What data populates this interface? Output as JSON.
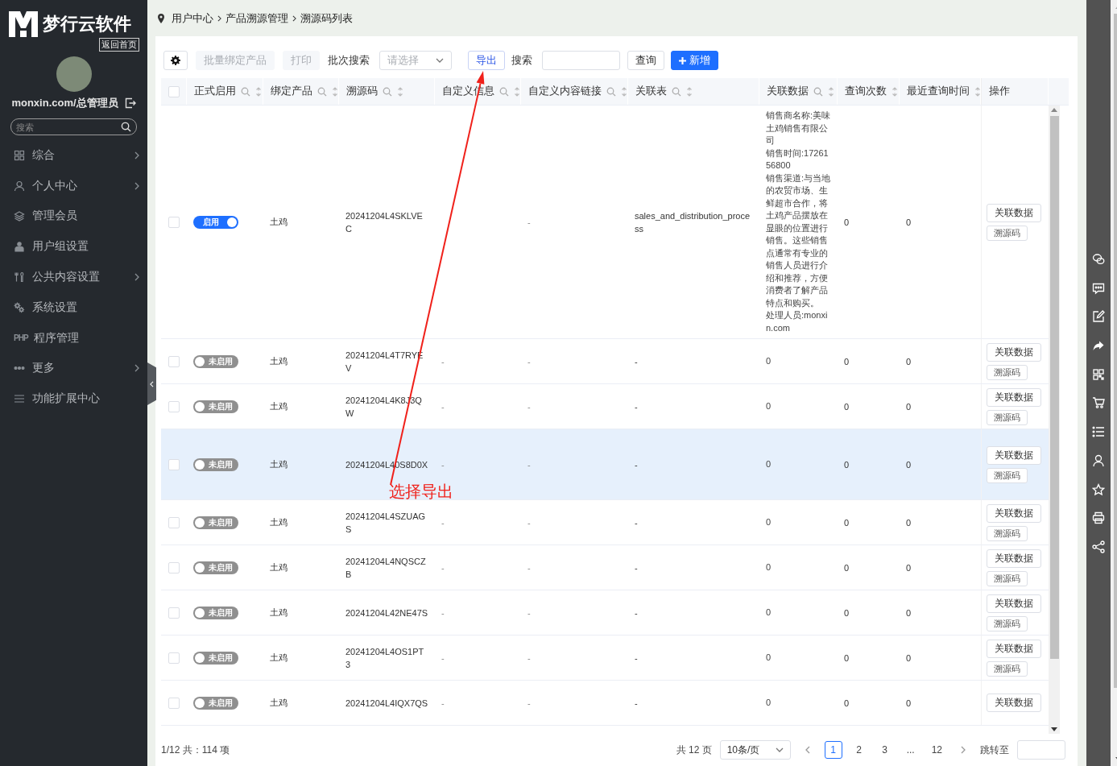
{
  "sidebar": {
    "brand": "梦行云软件",
    "home_link": "返回首页",
    "user": "monxin.com/总管理员",
    "search": {
      "placeholder": "搜索"
    },
    "items": [
      {
        "label": "综合",
        "expandable": true
      },
      {
        "label": "个人中心",
        "expandable": true
      },
      {
        "label": "管理会员",
        "expandable": false
      },
      {
        "label": "用户组设置",
        "expandable": false
      },
      {
        "label": "公共内容设置",
        "expandable": true
      },
      {
        "label": "系统设置",
        "expandable": false
      },
      {
        "label": "程序管理",
        "expandable": false,
        "icon_text": "PHP"
      },
      {
        "label": "更多",
        "expandable": true
      },
      {
        "label": "功能扩展中心",
        "expandable": false
      }
    ]
  },
  "breadcrumb": [
    "用户中心",
    "产品溯源管理",
    "溯源码列表"
  ],
  "toolbar": {
    "batch_bind": {
      "label": "批量绑定产品",
      "disabled": true
    },
    "print": {
      "label": "打印",
      "disabled": true
    },
    "batch_search": {
      "label": "批次搜索",
      "placeholder": "请选择"
    },
    "export": "导出",
    "search": {
      "label": "搜索"
    },
    "query": "查询",
    "add": "新增"
  },
  "table": {
    "all_checked": false,
    "columns": [
      {
        "label": "正式启用",
        "searchable": true,
        "sortable": true
      },
      {
        "label": "绑定产品",
        "searchable": true,
        "sortable": true
      },
      {
        "label": "溯源码",
        "searchable": true,
        "sortable": true
      },
      {
        "label": "自定义信息",
        "searchable": true,
        "sortable": true
      },
      {
        "label": "自定义内容链接",
        "searchable": true,
        "sortable": true
      },
      {
        "label": "关联表",
        "searchable": true,
        "sortable": true
      },
      {
        "label": "关联数据",
        "searchable": true,
        "sortable": true
      },
      {
        "label": "查询次数",
        "searchable": false,
        "sortable": true
      },
      {
        "label": "最近查询时间",
        "searchable": false,
        "sortable": true
      },
      {
        "label": "操作",
        "searchable": false,
        "sortable": false
      }
    ],
    "rows": [
      {
        "selected": false,
        "checked": false,
        "enabled": true,
        "toggle_label": "启用",
        "product": "土鸡",
        "code": "20241204L4SKLVEC",
        "custom_link": "-",
        "related_table": "sales_and_distribution_process",
        "related_data": [
          "销售商名称:美味土鸡销售有限公司",
          "销售时间:1726156800",
          "销售渠道:与当地的农贸市场、生鲜超市合作，将土鸡产品摆放在显眼的位置进行销售。这些销售点通常有专业的销售人员进行介绍和推荐，方便消费者了解产品特点和购买。",
          "处理人员:monxin.com"
        ],
        "query_count": "0",
        "last_query_time": "0",
        "actions": [
          "关联数据",
          "溯源码"
        ]
      },
      {
        "selected": false,
        "checked": false,
        "enabled": false,
        "toggle_label": "未启用",
        "product": "土鸡",
        "code": "20241204L4T7RYEV",
        "custom_info": "-",
        "custom_link": "-",
        "related_table": "-",
        "related_data": [
          "0"
        ],
        "query_count": "0",
        "last_query_time": "0",
        "actions": [
          "关联数据",
          "溯源码"
        ]
      },
      {
        "selected": false,
        "checked": false,
        "enabled": false,
        "toggle_label": "未启用",
        "product": "土鸡",
        "code": "20241204L4K8J3QW",
        "custom_info": "-",
        "custom_link": "-",
        "related_table": "-",
        "related_data": [
          "0"
        ],
        "query_count": "0",
        "last_query_time": "0",
        "actions": [
          "关联数据",
          "溯源码"
        ]
      },
      {
        "selected": true,
        "checked": false,
        "enabled": false,
        "toggle_label": "未启用",
        "product": "土鸡",
        "code": "20241204L40S8D0X",
        "custom_info": "-",
        "custom_link": "-",
        "related_table": "-",
        "related_data": [
          "0"
        ],
        "query_count": "0",
        "last_query_time": "0",
        "actions": [
          "关联数据",
          "溯源码"
        ]
      },
      {
        "selected": false,
        "checked": false,
        "enabled": false,
        "toggle_label": "未启用",
        "product": "土鸡",
        "code": "20241204L4SZUAGS",
        "custom_info": "-",
        "custom_link": "-",
        "related_table": "-",
        "related_data": [
          "0"
        ],
        "query_count": "0",
        "last_query_time": "0",
        "actions": [
          "关联数据",
          "溯源码"
        ]
      },
      {
        "selected": false,
        "checked": false,
        "enabled": false,
        "toggle_label": "未启用",
        "product": "土鸡",
        "code": "20241204L4NQSCZB",
        "custom_info": "-",
        "custom_link": "-",
        "related_table": "-",
        "related_data": [
          "0"
        ],
        "query_count": "0",
        "last_query_time": "0",
        "actions": [
          "关联数据",
          "溯源码"
        ]
      },
      {
        "selected": false,
        "checked": false,
        "enabled": false,
        "toggle_label": "未启用",
        "product": "土鸡",
        "code": "20241204L42NE47S",
        "custom_info": "-",
        "custom_link": "-",
        "related_table": "-",
        "related_data": [
          "0"
        ],
        "query_count": "0",
        "last_query_time": "0",
        "actions": [
          "关联数据",
          "溯源码"
        ]
      },
      {
        "selected": false,
        "checked": false,
        "enabled": false,
        "toggle_label": "未启用",
        "product": "土鸡",
        "code": "20241204L4OS1PT3",
        "custom_info": "-",
        "custom_link": "-",
        "related_table": "-",
        "related_data": [
          "0"
        ],
        "query_count": "0",
        "last_query_time": "0",
        "actions": [
          "关联数据",
          "溯源码"
        ]
      },
      {
        "selected": false,
        "checked": false,
        "enabled": false,
        "toggle_label": "未启用",
        "product": "土鸡",
        "code": "20241204L4IQX7QS",
        "custom_info": "-",
        "custom_link": "-",
        "related_table": "-",
        "related_data": [
          "0"
        ],
        "query_count": "0",
        "last_query_time": "0",
        "actions": [
          "关联数据"
        ]
      }
    ]
  },
  "pagination": {
    "summary": "1/12 共：114 项",
    "total_pages": "共 12 页",
    "page_size": "10条/页",
    "pages": [
      {
        "label": "1",
        "selected": true
      },
      {
        "label": "2",
        "selected": false
      },
      {
        "label": "3",
        "selected": false
      },
      {
        "label": "...",
        "selected": false
      },
      {
        "label": "12",
        "selected": false
      }
    ],
    "jump_label": "跳转至"
  },
  "annotation": {
    "text": "选择导出"
  }
}
